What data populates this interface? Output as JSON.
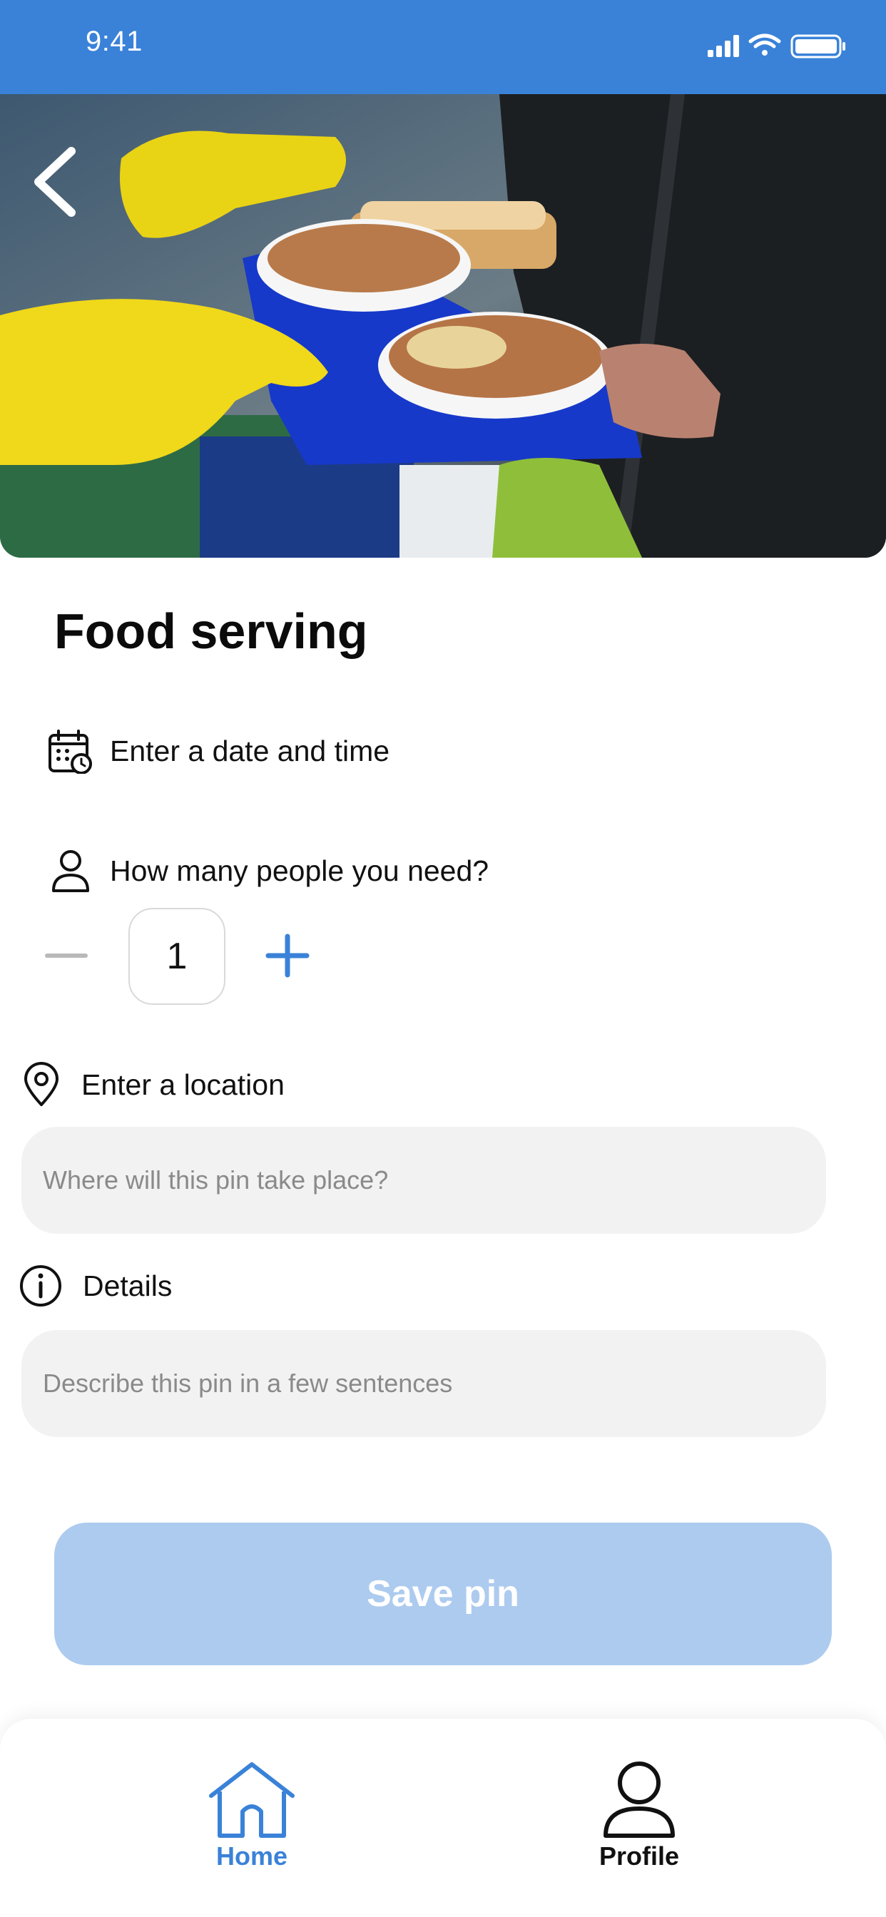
{
  "status_bar": {
    "time": "9:41"
  },
  "page": {
    "title": "Food serving"
  },
  "date_row": {
    "label": "Enter a date and time"
  },
  "people_row": {
    "label": "How many people you need?",
    "count": "1"
  },
  "location": {
    "label": "Enter a location",
    "placeholder": "Where will this pin take place?"
  },
  "details": {
    "label": "Details",
    "placeholder": "Describe this pin in a few sentences"
  },
  "save_button": {
    "label": "Save pin"
  },
  "tab_bar": {
    "items": [
      {
        "label": "Home",
        "icon": "home-icon",
        "active": true
      },
      {
        "label": "Profile",
        "icon": "profile-icon",
        "active": false
      }
    ]
  },
  "colors": {
    "accent": "#3a82d8",
    "button_disabled": "#adcbef",
    "input_bg": "#f2f2f2"
  }
}
